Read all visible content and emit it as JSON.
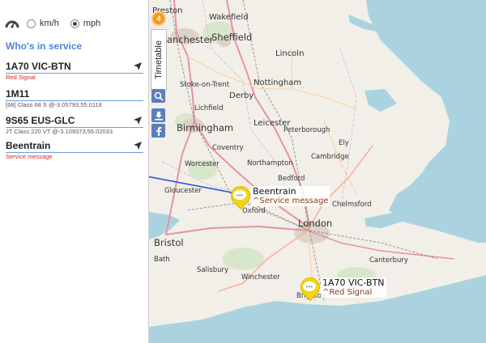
{
  "units": {
    "kmh_label": "km/h",
    "mph_label": "mph",
    "selected": "mph"
  },
  "panel": {
    "title": "Who's in service"
  },
  "services": [
    {
      "name": "1A70 VIC-BTN",
      "sub": "Red Signal",
      "sub_color": "#e02020"
    },
    {
      "name": "1M11",
      "sub": "[68] Class 68 S @-3.05793,55.0118",
      "sub_color": "#555555"
    },
    {
      "name": "9S65 EUS-GLC",
      "sub": "JT Class 220 VT @-3.109373,55.02033",
      "sub_color": "#555555"
    },
    {
      "name": "Beentrain",
      "sub": "Service message",
      "sub_color": "#e02020"
    }
  ],
  "toolbar": {
    "timetable_label": "Timetable",
    "badge_count": "4"
  },
  "map": {
    "places": [
      "Preston",
      "Wakefield",
      "Manchester",
      "Sheffield",
      "Lincoln",
      "Nottingham",
      "Stoke-on-Trent",
      "Derby",
      "Lichfield",
      "Leicester",
      "Birmingham",
      "Peterborough",
      "Ely",
      "Coventry",
      "Cambridge",
      "Northampton",
      "Bedford",
      "Worcester",
      "Gloucester",
      "Chelmsford",
      "Oxford",
      "London",
      "Bristol",
      "Canterbury",
      "Salisbury",
      "Winchester",
      "Brighton",
      "Bath"
    ],
    "markers": [
      {
        "name": "Beentrain",
        "message": "^Service message"
      },
      {
        "name": "1A70 VIC-BTN",
        "message": "^Red Signal"
      }
    ]
  },
  "colors": {
    "accent": "#4a86d8",
    "alert": "#e02020",
    "marker": "#f5d415",
    "badge": "#f39b1c",
    "sea": "#aad3df",
    "land": "#f2efe9"
  }
}
